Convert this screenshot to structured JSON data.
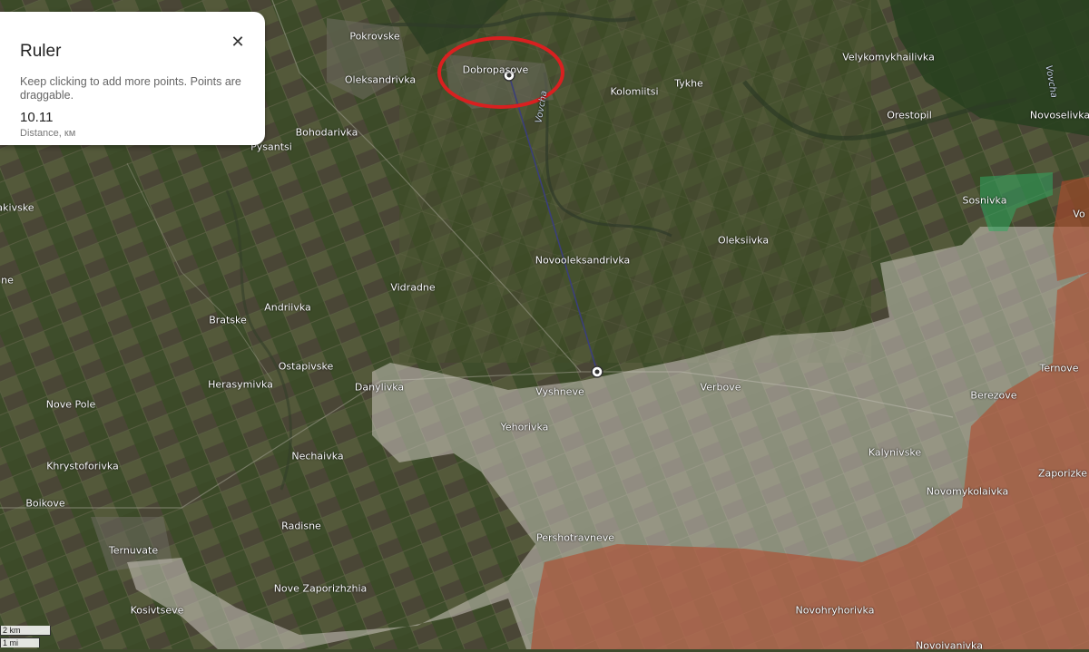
{
  "ruler": {
    "title": "Ruler",
    "close_icon": "close-icon",
    "hint": "Keep clicking to add more points. Points are draggable.",
    "distance_value": "10.11",
    "distance_label": "Distance, км"
  },
  "scale": {
    "km": "2 km",
    "mi": "1 mi"
  },
  "places": [
    "Pokrovske",
    "Oleksandrivka",
    "Dobropasove",
    "Kolomiitsi",
    "Tykhe",
    "Velykomykhailivka",
    "Orestopil",
    "Novoselivka",
    "Bohodarivka",
    "Pysantsi",
    "akivske",
    "Sosnivka",
    "Vo",
    "Oleksiivka",
    "Novooleksandrivka",
    "ne",
    "Vidradne",
    "Andriivka",
    "Bratske",
    "Ostapivske",
    "Ternove",
    "Herasymivka",
    "Danylivka",
    "Vyshneve",
    "Verbove",
    "Berezove",
    "Nove Pole",
    "Yehorivka",
    "Nechaivka",
    "Kalynivske",
    "Khrystoforivka",
    "Zaporizke",
    "Novomykolaivka",
    "Boikove",
    "Radisne",
    "Ternuvate",
    "Pershotravneve",
    "Nove Zaporizhzhia",
    "Kosivtseve",
    "Novohryhorivka",
    "Novoivanivka"
  ],
  "rivers": [
    "Vovcha",
    "Vovcha"
  ],
  "colors": {
    "route_line": "#3b3f7a",
    "highlight_circle": "#d92020",
    "grey_zone": "#c9c2bc",
    "red_zone": "#b04a2c",
    "green_zone": "#2fa860"
  }
}
